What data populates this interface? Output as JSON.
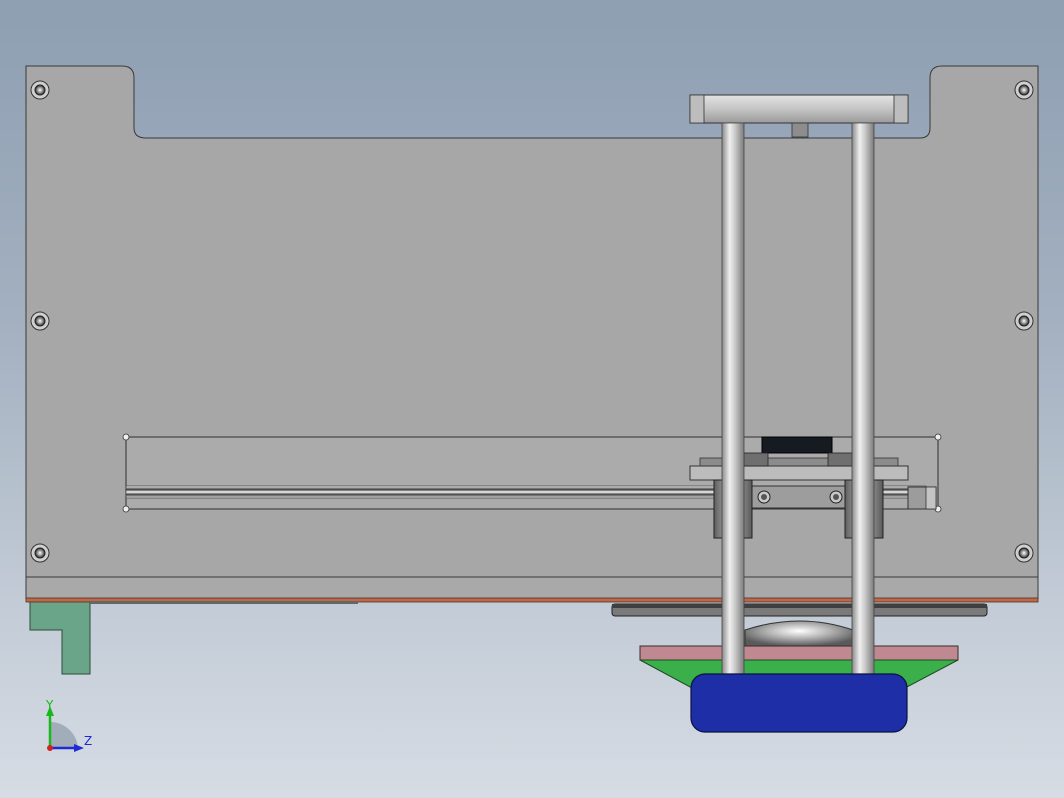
{
  "view": {
    "triad": {
      "y_label": "Y",
      "z_label": "Z",
      "colors": {
        "y": "#16b81c",
        "z": "#1f2ad6",
        "x": "#d42020"
      }
    },
    "colors": {
      "background_top": "#8e9fb2",
      "background_bottom": "#d6dce4",
      "frame_plate": "#a7a7a7",
      "green_mount": "#6aa58a",
      "pink_plate": "#c08890",
      "green_wedge": "#3bb04a",
      "blue_pad": "#1d2ea6"
    }
  }
}
